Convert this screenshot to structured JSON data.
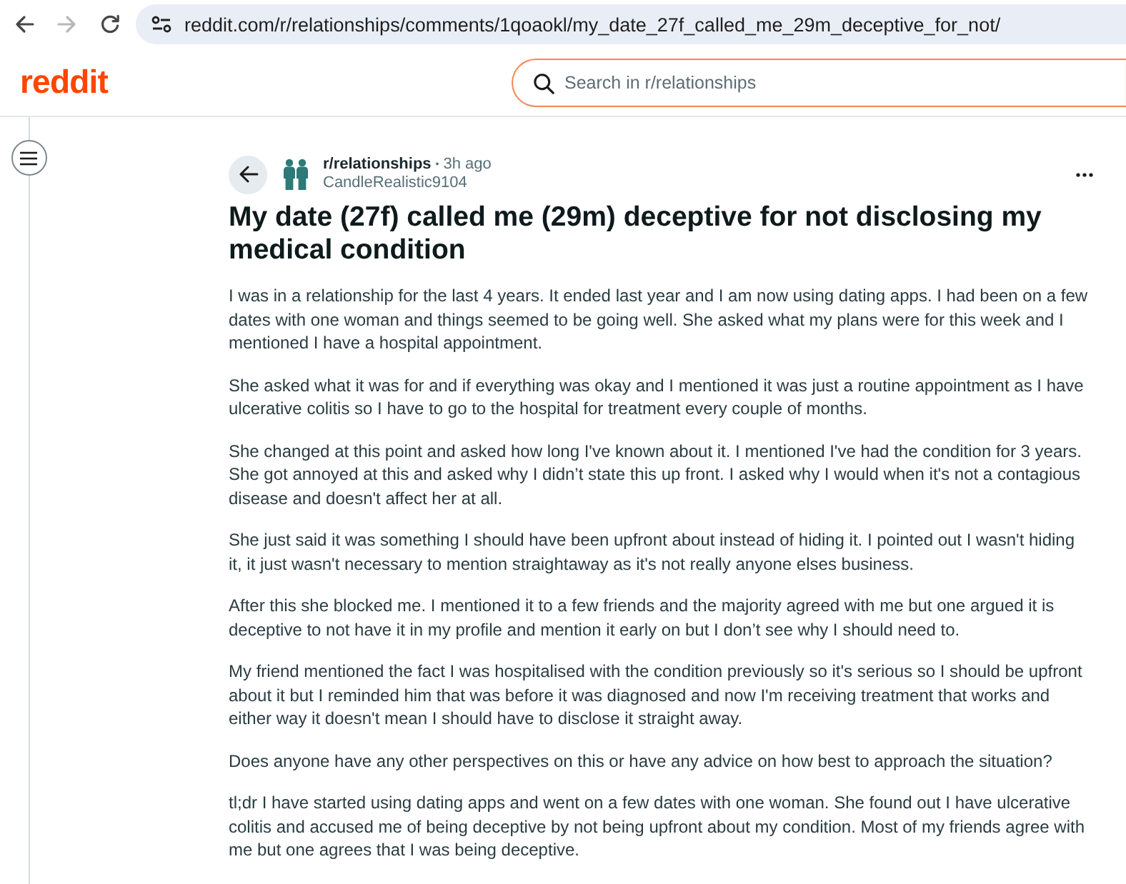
{
  "browser": {
    "nav_buttons": [
      {
        "kind": "back",
        "disabled": false
      },
      {
        "kind": "forward",
        "disabled": true
      },
      {
        "kind": "reload",
        "disabled": false
      }
    ],
    "url": "reddit.com/r/relationships/comments/1qoaokl/my_date_27f_called_me_29m_deceptive_for_not/"
  },
  "header": {
    "logo": "reddit",
    "search": {
      "placeholder": "Search in r/relationships"
    }
  },
  "post": {
    "subreddit": "r/relationships",
    "separator": "•",
    "age": "3h ago",
    "author": "CandleRealistic9104",
    "title": "My date (27f) called me (29m) deceptive for not disclosing my medical condition",
    "paragraphs": [
      "I was in a relationship for the last 4 years. It ended last year and I am now using dating apps. I had been on a few dates with one woman and things seemed to be going well. She asked what my plans were for this week and I mentioned I have a hospital appointment.",
      "She asked what it was for and if everything was okay and I mentioned it was just a routine appointment as I have ulcerative colitis so I have to go to the hospital for treatment every couple of months.",
      "She changed at this point and asked how long I've known about it. I mentioned I've had the condition for 3 years. She got annoyed at this and asked why I didn’t state this up front. I asked why I would when it's not a contagious disease and doesn't affect her at all.",
      "She just said it was something I should have been upfront about instead of hiding it. I pointed out I wasn't hiding it, it just wasn't necessary to mention straightaway as it's not really anyone elses business.",
      "After this she blocked me. I mentioned it to a few friends and the majority agreed with me but one argued it is deceptive to not have it in my profile and mention it early on but I don’t see why I should need to.",
      "My friend mentioned the fact I was hospitalised with the condition previously so it's serious so I should be upfront about it but I reminded him that was before it was diagnosed and now I'm receiving treatment that works and either way it doesn't mean I should have to disclose it straight away.",
      "Does anyone have any other perspectives on this or have any advice on how best to approach the situation?",
      "tl;dr I have started using dating apps and went on a few dates with one woman. She found out I have ulcerative colitis and accused me of being deceptive by not being upfront about my condition. Most of my friends agree with me but one agrees that I was being deceptive."
    ]
  }
}
